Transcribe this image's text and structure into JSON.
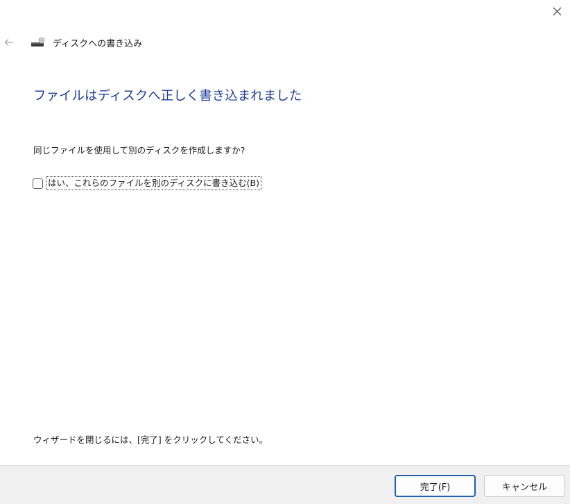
{
  "window": {
    "close_icon": "close-icon",
    "back_icon": "back-arrow-icon"
  },
  "header": {
    "title": "ディスクへの書き込み",
    "icon": "disc-drive-icon"
  },
  "content": {
    "heading": "ファイルはディスクへ正しく書き込まれました",
    "question": "同じファイルを使用して別のディスクを作成しますか?",
    "checkbox_label": "はい、これらのファイルを別のディスクに書き込む(B)",
    "checkbox_checked": false,
    "footer_note": "ウィザードを閉じるには、[完了] をクリックしてください。"
  },
  "buttons": {
    "finish_label": "完了(F)",
    "cancel_label": "キャンセル"
  },
  "colors": {
    "heading": "#1f3f9a",
    "default_button_border": "#1f5fb3",
    "button_bar_bg": "#f0f0f0"
  }
}
